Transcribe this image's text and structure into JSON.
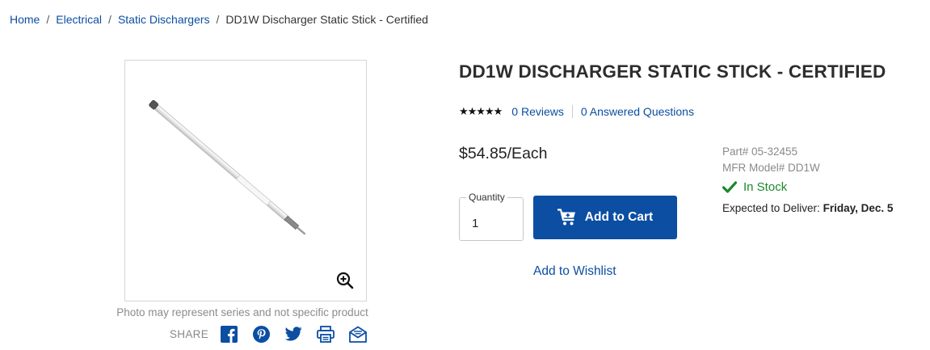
{
  "breadcrumb": {
    "items": [
      "Home",
      "Electrical",
      "Static Dischargers"
    ],
    "current": "DD1W Discharger Static Stick - Certified",
    "separator": "/"
  },
  "product": {
    "title": "DD1W DISCHARGER STATIC STICK - CERTIFIED",
    "stars": "★★★★★",
    "reviews_link": "0 Reviews",
    "questions_link": "0 Answered Questions",
    "price": "$54.85/Each",
    "part_number": "Part# 05-32455",
    "mfr_model": "MFR Model# DD1W",
    "stock_status": "In Stock",
    "deliver_label": "Expected to Deliver:",
    "deliver_date": "Friday, Dec. 5"
  },
  "purchase": {
    "quantity_label": "Quantity",
    "quantity_value": "1",
    "add_to_cart": "Add to Cart",
    "add_to_wishlist": "Add to Wishlist"
  },
  "image": {
    "note": "Photo may represent series and not specific product"
  },
  "share": {
    "label": "SHARE",
    "icons": [
      "facebook-icon",
      "pinterest-icon",
      "twitter-icon",
      "print-icon",
      "email-icon"
    ]
  },
  "colors": {
    "link_blue": "#0b4ea2",
    "button_blue": "#0b4ea2",
    "stock_green": "#1a8a2a"
  }
}
